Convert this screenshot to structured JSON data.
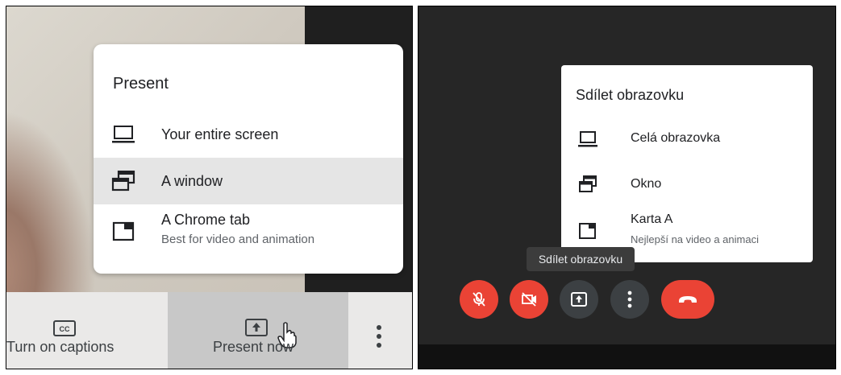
{
  "left": {
    "menu": {
      "title": "Present",
      "items": [
        {
          "label": "Your entire screen",
          "icon": "laptop-icon",
          "selected": false
        },
        {
          "label": "A window",
          "icon": "window-icon",
          "selected": true
        },
        {
          "label": "A Chrome tab",
          "sublabel": "Best for video and animation",
          "icon": "chrome-tab-icon",
          "selected": false
        }
      ]
    },
    "bottom_bar": {
      "captions_label": "Turn on captions",
      "present_label": "Present now"
    }
  },
  "right": {
    "menu": {
      "title": "Sdílet obrazovku",
      "items": [
        {
          "label": "Celá obrazovka",
          "icon": "laptop-icon"
        },
        {
          "label": "Okno",
          "icon": "window-icon"
        },
        {
          "label": "Karta A",
          "sublabel": "Nejlepší na video a animaci",
          "icon": "chrome-tab-icon"
        }
      ]
    },
    "tooltip": "Sdílet obrazovku",
    "controls": [
      "mic-off-icon",
      "camera-off-icon",
      "present-screen-icon",
      "more-vert-icon",
      "hang-up-icon"
    ],
    "colors": {
      "red": "#ea4335",
      "dark_button": "#3c4043",
      "background": "#262626"
    }
  }
}
